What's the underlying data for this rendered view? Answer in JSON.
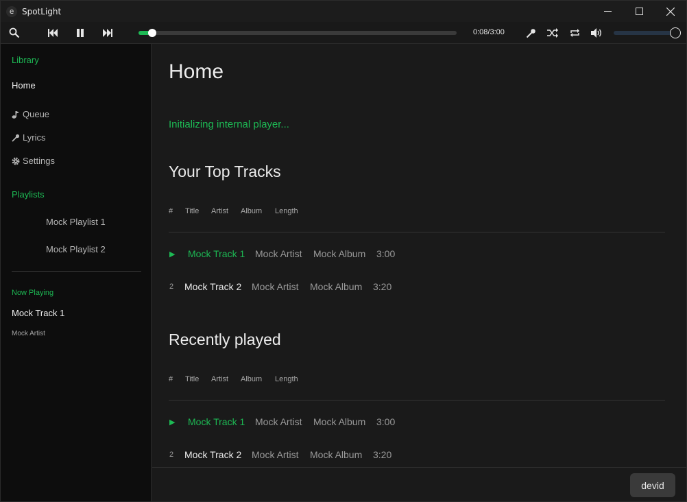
{
  "window": {
    "app_icon_letter": "e",
    "title": "SpotLight",
    "minimize_glyph": "—",
    "maximize_glyph": "☐",
    "close_glyph": "✕"
  },
  "player": {
    "time": "0:08/3:00",
    "progress_fraction": 0.044,
    "volume_fraction": 1.0,
    "icons": [
      "search-icon",
      "previous-icon",
      "pause-icon",
      "next-icon",
      "lyrics-icon",
      "shuffle-icon",
      "repeat-icon",
      "volume-icon"
    ]
  },
  "colors": {
    "accent": "#1db954",
    "sidebar_bg": "#0d0d0d",
    "main_bg": "#1a1a1a",
    "volume_track": "#263445"
  },
  "sidebar": {
    "library_heading": "Library",
    "home": "Home",
    "queue": "Queue",
    "lyrics": "Lyrics",
    "settings": "Settings",
    "playlists_heading": "Playlists",
    "playlists": [
      "Mock Playlist 1",
      "Mock Playlist 2"
    ],
    "now_playing_label": "Now Playing",
    "now_playing_title": "Mock Track 1",
    "now_playing_artist": "Mock Artist"
  },
  "main": {
    "title": "Home",
    "status": "Initializing internal player...",
    "columns": [
      "#",
      "Title",
      "Artist",
      "Album",
      "Length"
    ],
    "sections": [
      {
        "title": "Your Top Tracks",
        "rows": [
          {
            "num": "▶",
            "title": "Mock Track 1",
            "artist": "Mock Artist",
            "album": "Mock Album",
            "length": "3:00"
          },
          {
            "num": "2",
            "title": "Mock Track 2",
            "artist": "Mock Artist",
            "album": "Mock Album",
            "length": "3:20"
          }
        ]
      },
      {
        "title": "Recently played",
        "rows": [
          {
            "num": "▶",
            "title": "Mock Track 1",
            "artist": "Mock Artist",
            "album": "Mock Album",
            "length": "3:00"
          },
          {
            "num": "2",
            "title": "Mock Track 2",
            "artist": "Mock Artist",
            "album": "Mock Album",
            "length": "3:20"
          }
        ]
      }
    ]
  },
  "user": {
    "name": "devid"
  }
}
